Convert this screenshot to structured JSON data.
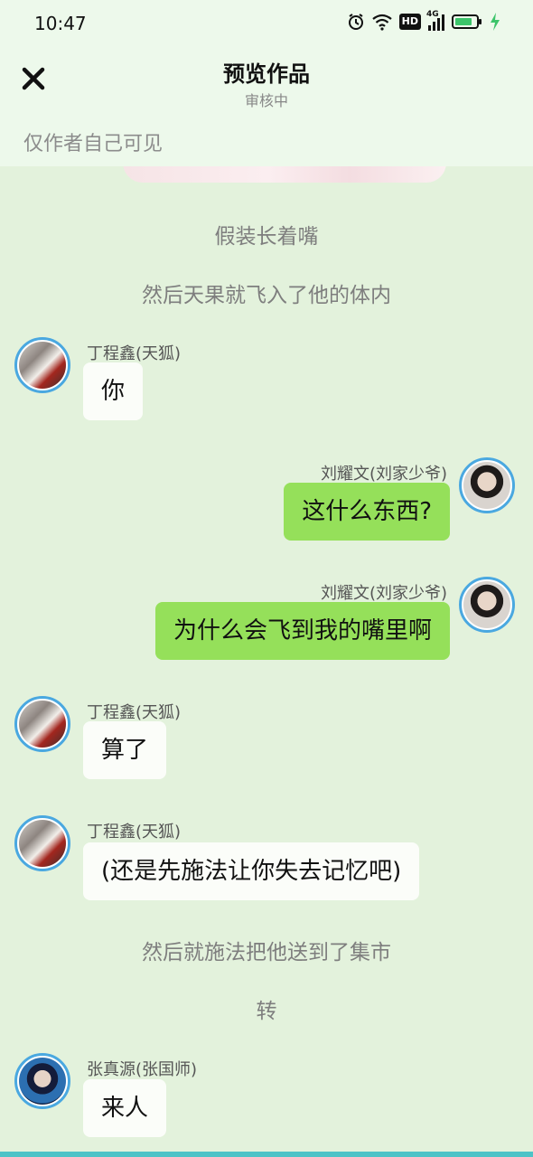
{
  "status_bar": {
    "time": "10:47",
    "network": "4G",
    "hd": "HD",
    "icons": [
      "alarm-icon",
      "wifi-icon",
      "hd-icon",
      "signal-icon",
      "battery-icon",
      "charging-icon"
    ]
  },
  "header": {
    "title": "预览作品",
    "subtitle": "审核中",
    "visibility_note": "仅作者自己可见",
    "close_icon": "close-icon"
  },
  "colors": {
    "background": "#e3f2dc",
    "header_bg": "#edf9eb",
    "right_bubble": "#95e05a",
    "left_bubble": "#fbfdf9",
    "avatar_border": "#4aa8e0",
    "bottom_bar": "#4dc3c7"
  },
  "messages": [
    {
      "type": "narration",
      "text": "假装长着嘴"
    },
    {
      "type": "narration",
      "text": "然后天果就飞入了他的体内"
    },
    {
      "type": "chat",
      "side": "left",
      "speaker": "丁程鑫(天狐)",
      "text": "你"
    },
    {
      "type": "chat",
      "side": "right",
      "speaker": "刘耀文(刘家少爷)",
      "text": "这什么东西?"
    },
    {
      "type": "chat",
      "side": "right",
      "speaker": "刘耀文(刘家少爷)",
      "text": "为什么会飞到我的嘴里啊"
    },
    {
      "type": "chat",
      "side": "left",
      "speaker": "丁程鑫(天狐)",
      "text": "算了"
    },
    {
      "type": "chat",
      "side": "left",
      "speaker": "丁程鑫(天狐)",
      "text": "(还是先施法让你失去记忆吧)"
    },
    {
      "type": "narration",
      "text": "然后就施法把他送到了集市"
    },
    {
      "type": "narration",
      "text": "转"
    },
    {
      "type": "chat",
      "side": "left",
      "speaker": "张真源(张国师)",
      "text": "来人"
    }
  ]
}
